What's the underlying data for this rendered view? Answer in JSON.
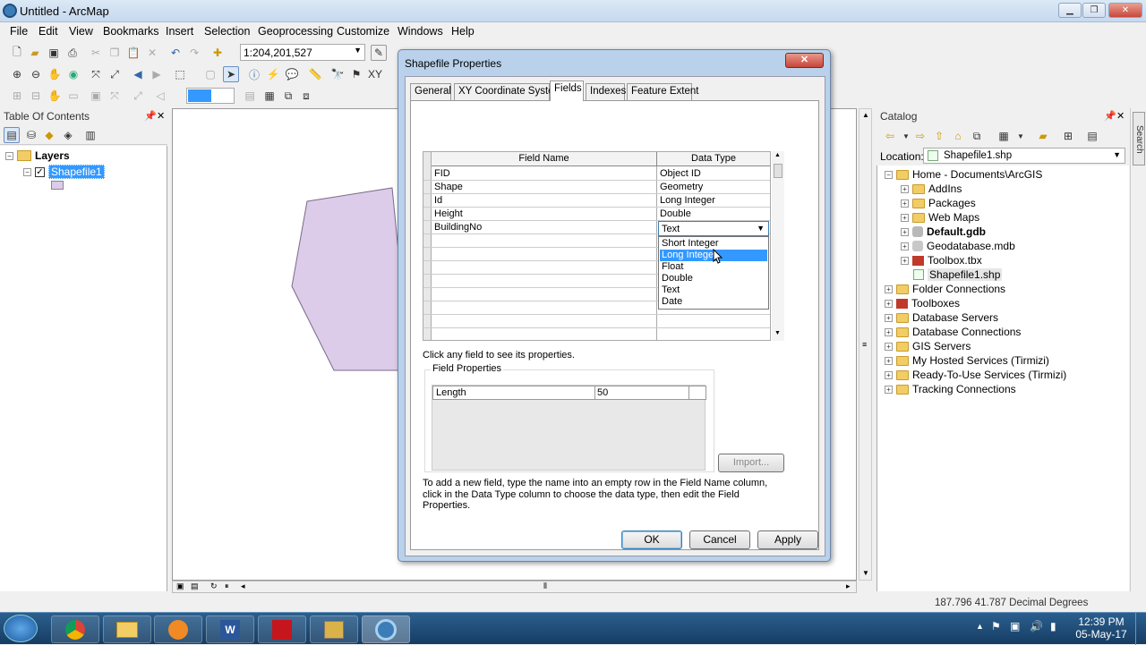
{
  "app": {
    "title": "Untitled - ArcMap",
    "win_min": "▁",
    "win_max": "❐",
    "win_close": "✕"
  },
  "menu": [
    "File",
    "Edit",
    "View",
    "Bookmarks",
    "Insert",
    "Selection",
    "Geoprocessing",
    "Customize",
    "Windows",
    "Help"
  ],
  "toolbar": {
    "scale": "1:204,201,527"
  },
  "toc": {
    "title": "Table Of Contents",
    "layers_label": "Layers",
    "layer_name": "Shapefile1",
    "pin": "ᵖ",
    "close": "✕"
  },
  "catalog": {
    "title": "Catalog",
    "location_label": "Location:",
    "location_value": "Shapefile1.shp",
    "search_tab": "Search",
    "items": [
      {
        "label": "Home - Documents\\ArcGIS",
        "bold": false
      },
      {
        "label": "AddIns",
        "bold": false
      },
      {
        "label": "Packages",
        "bold": false
      },
      {
        "label": "Web Maps",
        "bold": false
      },
      {
        "label": "Default.gdb",
        "bold": true
      },
      {
        "label": "Geodatabase.mdb",
        "bold": false
      },
      {
        "label": "Toolbox.tbx",
        "bold": false
      },
      {
        "label": "Shapefile1.shp",
        "bold": false
      },
      {
        "label": "Folder Connections",
        "bold": false
      },
      {
        "label": "Toolboxes",
        "bold": false
      },
      {
        "label": "Database Servers",
        "bold": false
      },
      {
        "label": "Database Connections",
        "bold": false
      },
      {
        "label": "GIS Servers",
        "bold": false
      },
      {
        "label": "My Hosted Services (Tirmizi)",
        "bold": false
      },
      {
        "label": "Ready-To-Use Services (Tirmizi)",
        "bold": false
      },
      {
        "label": "Tracking Connections",
        "bold": false
      }
    ]
  },
  "dialog": {
    "title": "Shapefile Properties",
    "close": "✕",
    "tabs": [
      "General",
      "XY Coordinate System",
      "Fields",
      "Indexes",
      "Feature Extent"
    ],
    "active_tab": "Fields",
    "col_field": "Field Name",
    "col_type": "Data Type",
    "rows": [
      {
        "name": "FID",
        "type": "Object ID"
      },
      {
        "name": "Shape",
        "type": "Geometry"
      },
      {
        "name": "Id",
        "type": "Long Integer"
      },
      {
        "name": "Height",
        "type": "Double"
      },
      {
        "name": "BuildingNo",
        "type": "Text"
      }
    ],
    "dropdown_options": [
      "Short Integer",
      "Long Integer",
      "Float",
      "Double",
      "Text",
      "Date"
    ],
    "dropdown_highlighted": "Long Integer",
    "hint": "Click any field to see its properties.",
    "field_props_label": "Field Properties",
    "prop_name": "Length",
    "prop_value": "50",
    "import_btn": "Import...",
    "help_text": "To add a new field, type the name into an empty row in the Field Name column, click in the Data Type column to choose the data type, then edit the Field Properties.",
    "ok": "OK",
    "cancel": "Cancel",
    "apply": "Apply"
  },
  "status": {
    "coords": "187.796  41.787 Decimal Degrees"
  },
  "clock": {
    "time": "12:39 PM",
    "date": "05-May-17"
  },
  "colors": {
    "polygon_fill": "#dccbe9",
    "selection": "#3399ff"
  }
}
